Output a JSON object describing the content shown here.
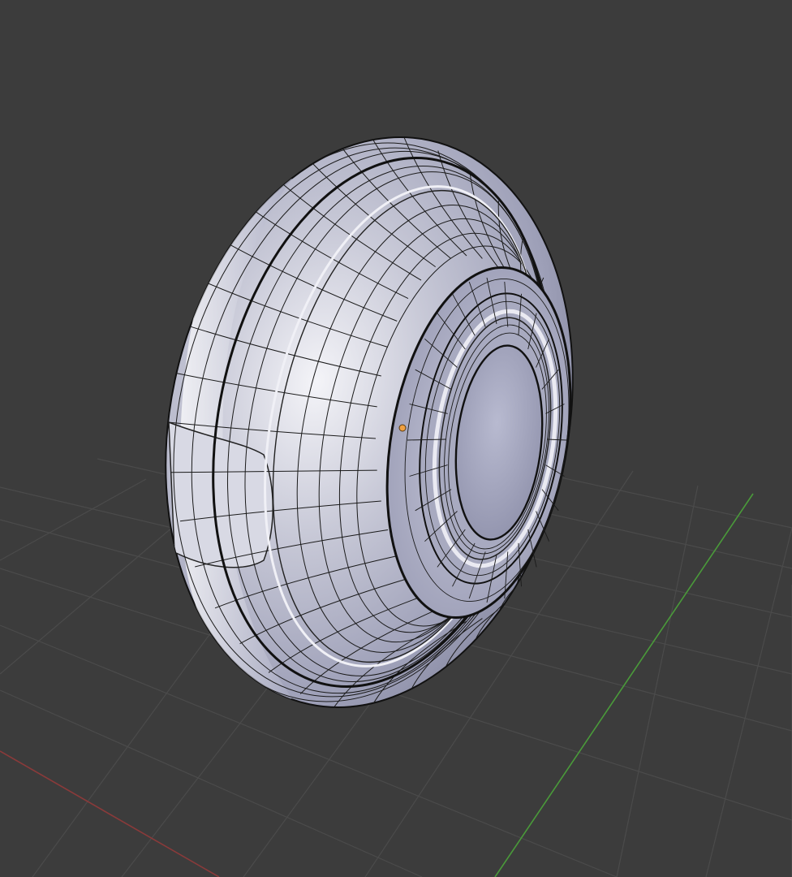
{
  "viewport": {
    "background_color": "#3c3c3c",
    "grid_color": "#4b4b4b",
    "x_axis_color": "#8a3a3a",
    "y_axis_color": "#4a9a3a",
    "mesh_base_color": "#aeb0c8",
    "wire_color": "#1a1a1a",
    "origin_color": "#f0a040"
  },
  "scene": {
    "object_type": "tire-wheel-mesh",
    "shading": "solid",
    "overlay": "wireframe"
  },
  "icons": {
    "origin": "object-origin-dot"
  }
}
